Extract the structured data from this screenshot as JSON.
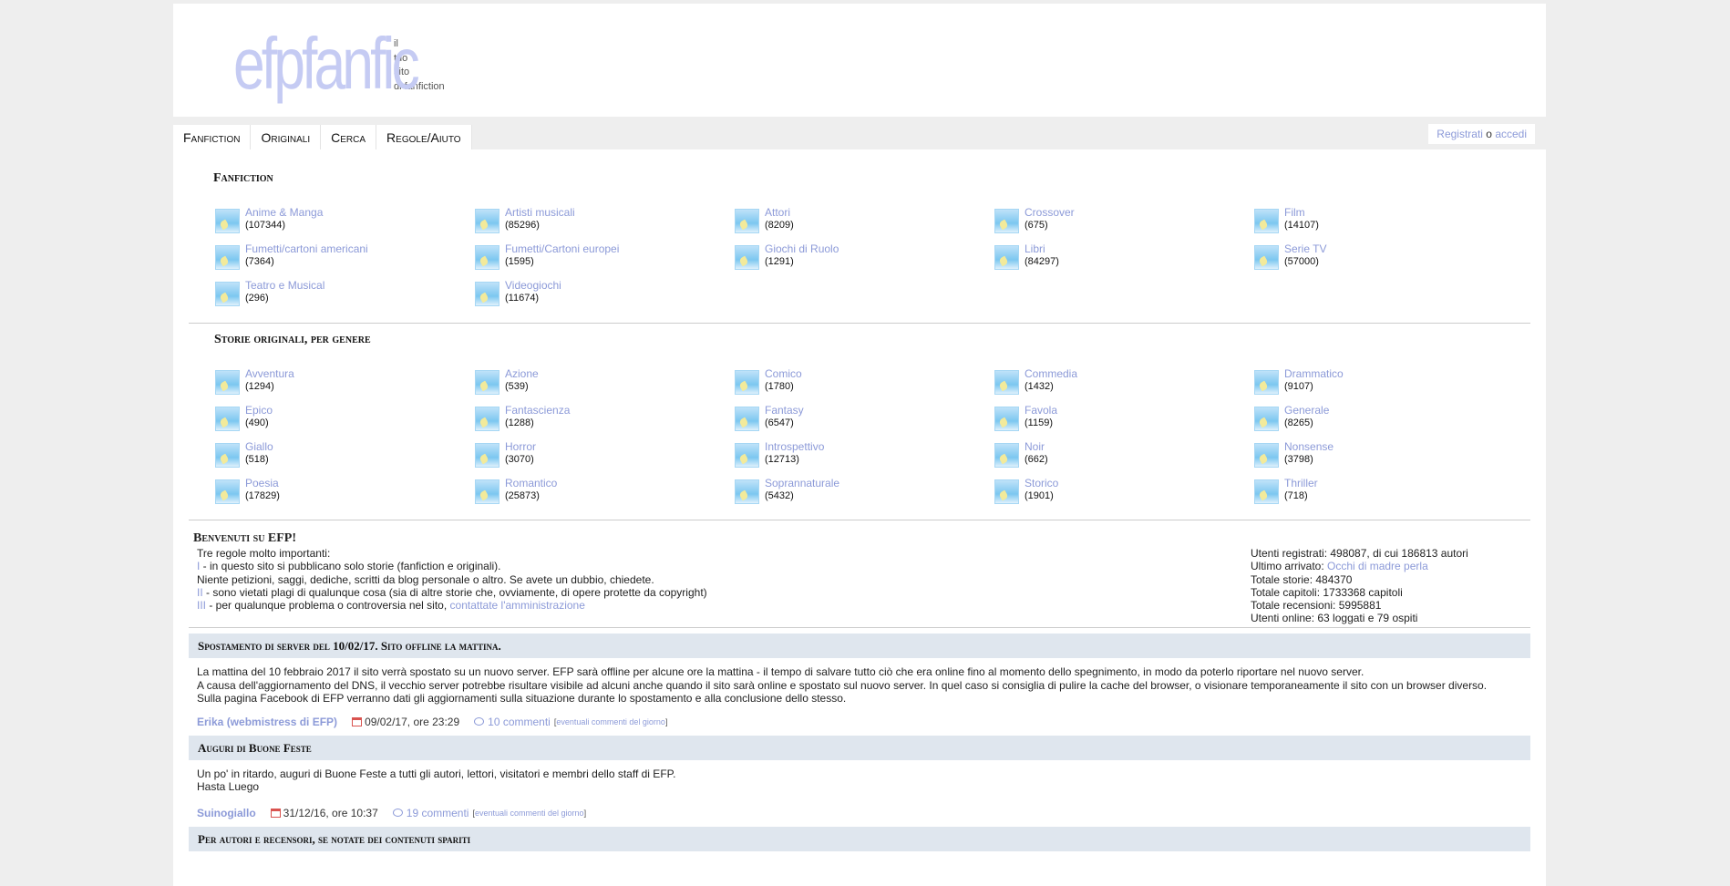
{
  "logo": {
    "word": "efpfanfic",
    "tagline": [
      "il",
      "tuo",
      "sito",
      "di fanfiction"
    ]
  },
  "nav": {
    "tabs": [
      "Fanfiction",
      "Originali",
      "Cerca",
      "Regole/Aiuto"
    ]
  },
  "login": {
    "register": "Registrati",
    "sep": " o ",
    "login": "accedi"
  },
  "fanfiction": {
    "title": "Fanfiction",
    "items": [
      {
        "name": "Anime & Manga",
        "count": "(107344)"
      },
      {
        "name": "Artisti musicali",
        "count": "(85296)"
      },
      {
        "name": "Attori",
        "count": "(8209)"
      },
      {
        "name": "Crossover",
        "count": "(675)"
      },
      {
        "name": "Film",
        "count": "(14107)"
      },
      {
        "name": "Fumetti/cartoni americani",
        "count": "(7364)"
      },
      {
        "name": "Fumetti/Cartoni europei",
        "count": "(1595)"
      },
      {
        "name": "Giochi di Ruolo",
        "count": "(1291)"
      },
      {
        "name": "Libri",
        "count": "(84297)"
      },
      {
        "name": "Serie TV",
        "count": "(57000)"
      },
      {
        "name": "Teatro e Musical",
        "count": "(296)"
      },
      {
        "name": "Videogiochi",
        "count": "(11674)"
      }
    ]
  },
  "originali": {
    "title": "Storie originali, per genere",
    "items": [
      {
        "name": "Avventura",
        "count": "(1294)"
      },
      {
        "name": "Azione",
        "count": "(539)"
      },
      {
        "name": "Comico",
        "count": "(1780)"
      },
      {
        "name": "Commedia",
        "count": "(1432)"
      },
      {
        "name": "Drammatico",
        "count": "(9107)"
      },
      {
        "name": "Epico",
        "count": "(490)"
      },
      {
        "name": "Fantascienza",
        "count": "(1288)"
      },
      {
        "name": "Fantasy",
        "count": "(6547)"
      },
      {
        "name": "Favola",
        "count": "(1159)"
      },
      {
        "name": "Generale",
        "count": "(8265)"
      },
      {
        "name": "Giallo",
        "count": "(518)"
      },
      {
        "name": "Horror",
        "count": "(3070)"
      },
      {
        "name": "Introspettivo",
        "count": "(12713)"
      },
      {
        "name": "Noir",
        "count": "(662)"
      },
      {
        "name": "Nonsense",
        "count": "(3798)"
      },
      {
        "name": "Poesia",
        "count": "(17829)"
      },
      {
        "name": "Romantico",
        "count": "(25873)"
      },
      {
        "name": "Soprannaturale",
        "count": "(5432)"
      },
      {
        "name": "Storico",
        "count": "(1901)"
      },
      {
        "name": "Thriller",
        "count": "(718)"
      }
    ]
  },
  "welcome": {
    "title": "Benvenuti su EFP!",
    "intro": "Tre regole molto importanti:",
    "rule1_num": "I",
    "rule1": " - in questo sito si pubblicano solo storie (fanfiction e originali).",
    "rule1b": "Niente petizioni, saggi, dediche, scritti da blog personale o altro. Se avete un dubbio, chiedete.",
    "rule2_num": "II",
    "rule2": " - sono vietati plagi di qualunque cosa (sia di altre storie che, ovviamente, di opere protette da copyright)",
    "rule3_num": "III",
    "rule3": " - per qualunque problema o controversia nel sito, ",
    "rule3_link": "contattate l'amministrazione"
  },
  "stats": {
    "users": "Utenti registrati: 498087, di cui 186813 autori",
    "last_label": "Ultimo arrivato: ",
    "last_user": "Occhi di madre perla",
    "stories": "Totale storie: 484370",
    "chapters": "Totale capitoli: 1733368 capitoli",
    "reviews": "Totale recensioni: 5995881",
    "online": "Utenti online: 63 loggati e 79 ospiti"
  },
  "news": [
    {
      "title": "Spostamento di server del 10/02/17. Sito offline la mattina.",
      "lines": [
        "La mattina del 10 febbraio 2017 il sito verrà spostato su un nuovo server. EFP sarà offline per alcune ore la mattina - il tempo di salvare tutto ciò che era online fino al momento dello spegnimento, in modo da poterlo riportare nel nuovo server.",
        "A causa dell'aggiornamento del DNS, il vecchio server potrebbe risultare visibile ad alcuni anche quando il sito sarà online e spostato sul nuovo server. In quel caso si consiglia di pulire la cache del browser, o visionare temporaneamente il sito con un browser diverso.",
        "Sulla pagina Facebook di EFP verranno dati gli aggiornamenti sulla situazione durante lo spostamento e alla conclusione dello stesso."
      ],
      "author": "Erika (webmistress di EFP)",
      "date": "09/02/17, ore 23:29",
      "comments": "10 commenti",
      "day_comments": "eventuali commenti del giorno"
    },
    {
      "title": "Auguri di Buone Feste",
      "lines": [
        "Un po' in ritardo, auguri di Buone Feste a tutti gli autori, lettori, visitatori e membri dello staff di EFP.",
        "Hasta Luego"
      ],
      "author": "Suinogiallo",
      "date": "31/12/16, ore 10:37",
      "comments": "19 commenti",
      "day_comments": "eventuali commenti del giorno"
    },
    {
      "title": "Per autori e recensori, se notate dei contenuti spariti"
    }
  ]
}
